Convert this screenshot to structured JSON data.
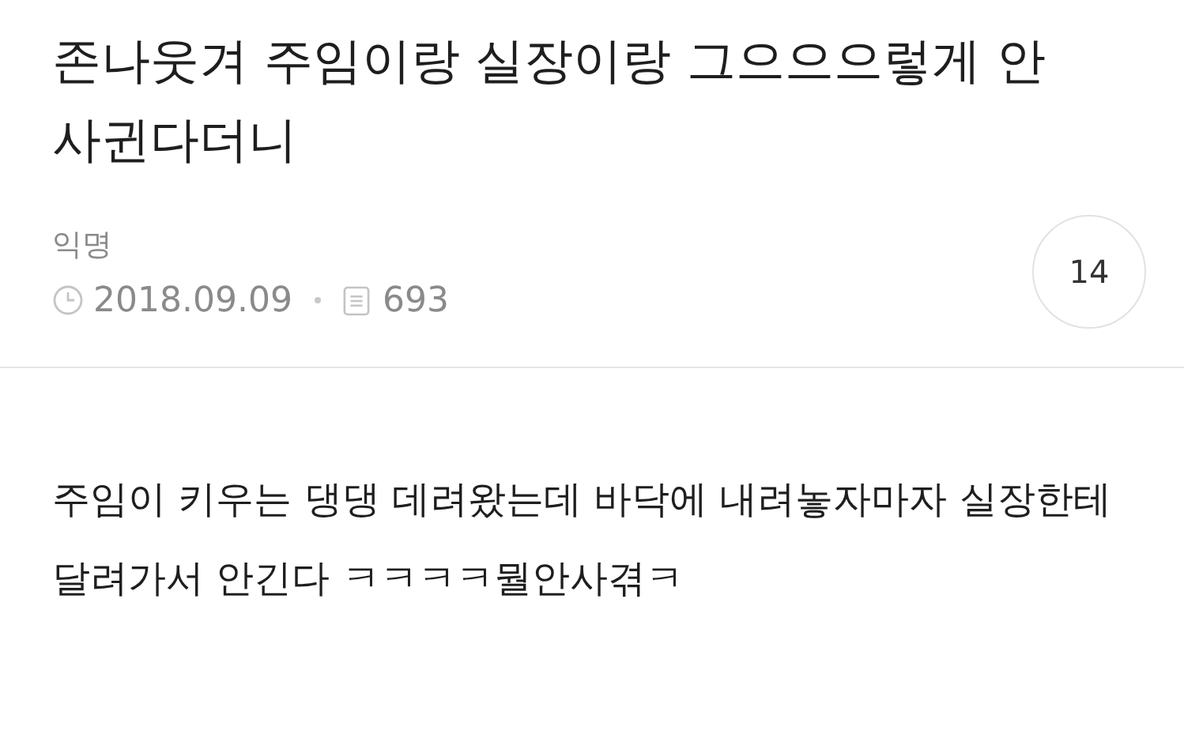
{
  "post": {
    "title": "존나웃겨 주임이랑 실장이랑 그으으으렇게 안사귄다더니",
    "author": "익명",
    "date": "2018.09.09",
    "views": "693",
    "comment_count": "14",
    "body": "주임이 키우는 댕댕 데려왔는데 바닥에 내려놓자마자 실장한테 달려가서 안긴다 ㅋㅋㅋㅋ뭘안사겪ㅋ"
  }
}
